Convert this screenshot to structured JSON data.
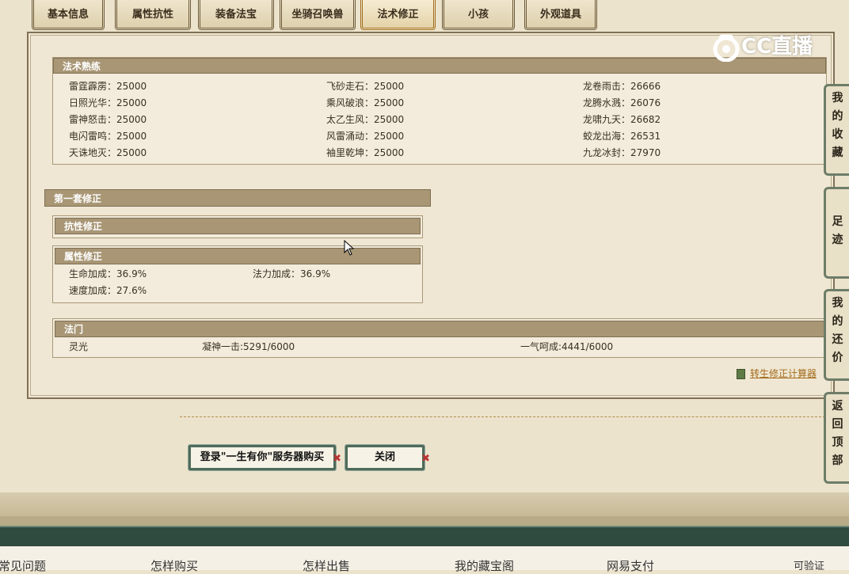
{
  "tabs": [
    {
      "label": "基本信息"
    },
    {
      "label": "属性抗性"
    },
    {
      "label": "装备法宝"
    },
    {
      "label": "坐骑召唤兽"
    },
    {
      "label": "法术修正"
    },
    {
      "label": "小孩"
    },
    {
      "label": "外观道具"
    }
  ],
  "active_tab": "法术修正",
  "logo_text": "CC直播",
  "spell_mastery": {
    "title": "法术熟练",
    "rows": [
      [
        "雷霆霹雳：25000",
        "飞砂走石：25000",
        "龙卷雨击：26666"
      ],
      [
        "日照光华：25000",
        "乘风破浪：25000",
        "龙腾水溅：26076"
      ],
      [
        "雷神怒击：25000",
        "太乙生风：25000",
        "龙啸九天：26682"
      ],
      [
        "电闪雷鸣：25000",
        "风雷涌动：25000",
        "蛟龙出海：26531"
      ],
      [
        "天诛地灭：25000",
        "袖里乾坤：25000",
        "九龙冰封：27970"
      ]
    ]
  },
  "correction_set": {
    "title": "第一套修正",
    "resist_title": "抗性修正",
    "attr_title": "属性修正",
    "attr_rows": [
      [
        "生命加成：36.9%",
        "法力加成：36.9%"
      ],
      [
        "速度加成：27.6%",
        ""
      ]
    ]
  },
  "school": {
    "title": "法门",
    "items": [
      "灵光",
      "凝神一击:5291/6000",
      "一气呵成:4441/6000"
    ]
  },
  "calc_link": "转生修正计算器",
  "buttons": {
    "login_buy": "登录\"一生有你\"服务器购买",
    "close": "关闭"
  },
  "side_tabs": [
    {
      "label": "我的收藏"
    },
    {
      "label": "足迹"
    },
    {
      "label": "我的还价"
    },
    {
      "label": "返回顶部"
    }
  ],
  "footer": [
    "常见问题",
    "怎样购买",
    "怎样出售",
    "我的藏宝阁",
    "网易支付",
    "可验证"
  ]
}
